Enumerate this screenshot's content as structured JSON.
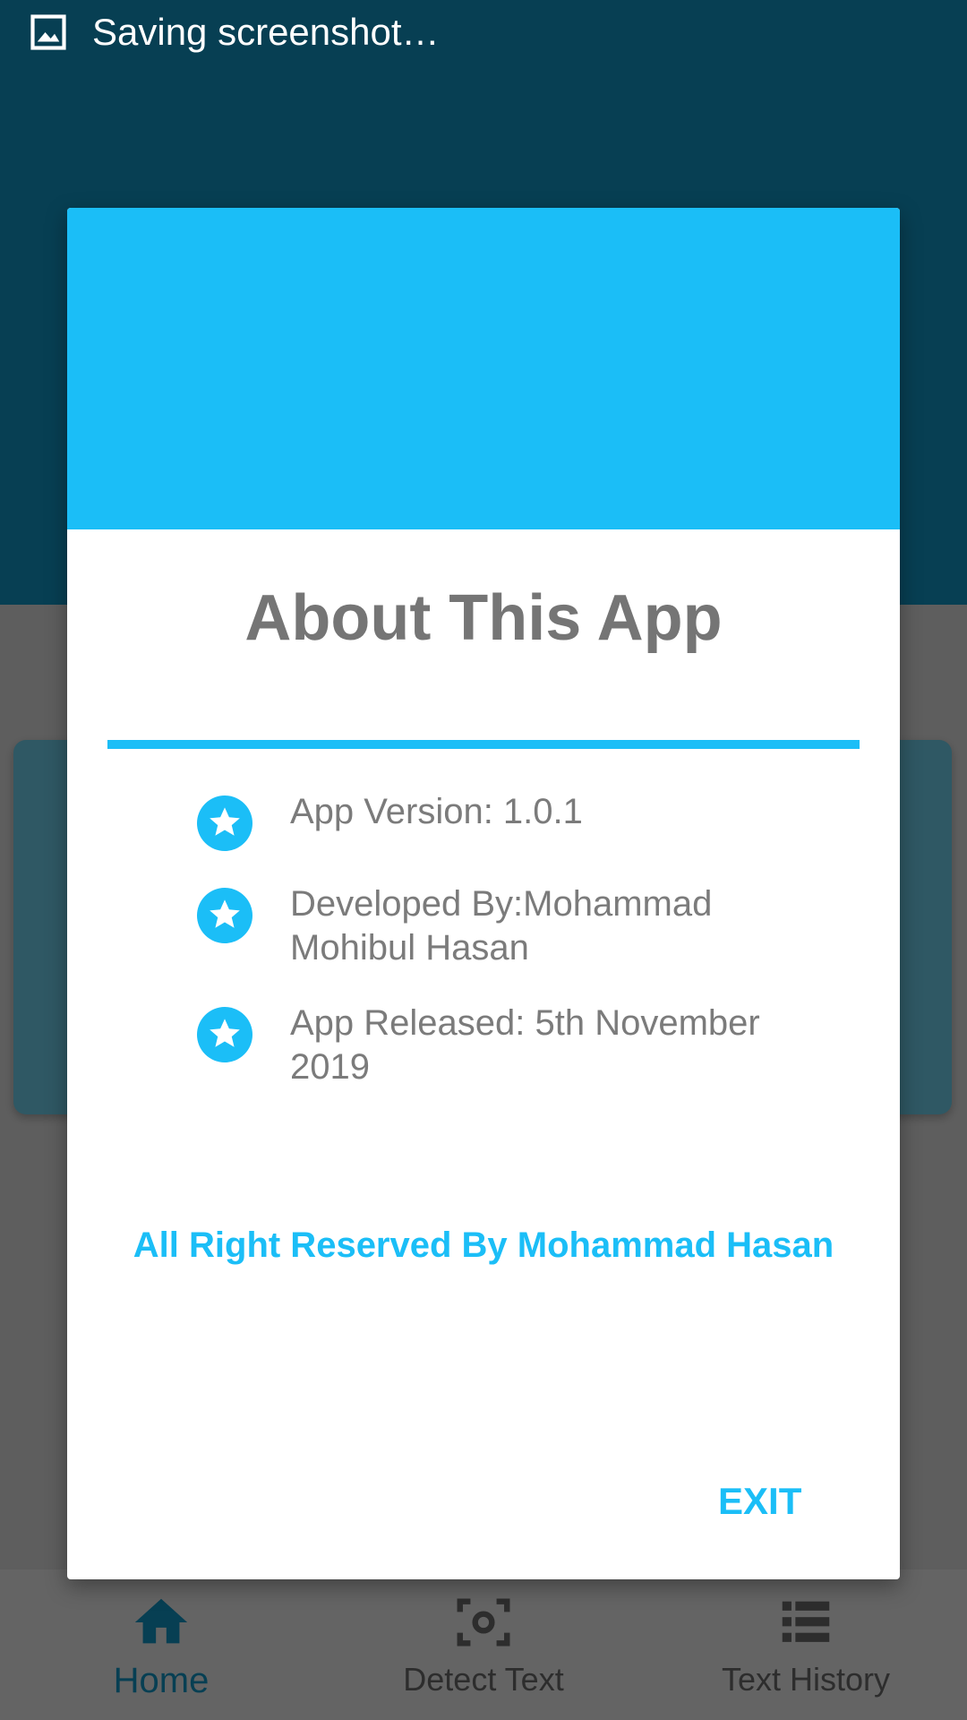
{
  "status_bar": {
    "text": "Saving screenshot…",
    "icon": "image-icon"
  },
  "bottom_nav": {
    "items": [
      {
        "label": "Home",
        "icon": "home-icon",
        "active": true
      },
      {
        "label": "Detect Text",
        "icon": "scan-icon",
        "active": false
      },
      {
        "label": "Text History",
        "icon": "list-icon",
        "active": false
      }
    ]
  },
  "dialog": {
    "title": "About This App",
    "items": [
      {
        "icon": "star-icon",
        "text": "App Version: 1.0.1"
      },
      {
        "icon": "star-icon",
        "text": "Developed By:Mohammad Mohibul Hasan"
      },
      {
        "icon": "star-icon",
        "text": "App Released: 5th November 2019"
      }
    ],
    "rights": "All Right Reserved By Mohammad Hasan",
    "exit_label": "EXIT"
  },
  "colors": {
    "accent": "#1bbef7",
    "primary": "#0e7fa6",
    "text_gray": "#757575"
  }
}
